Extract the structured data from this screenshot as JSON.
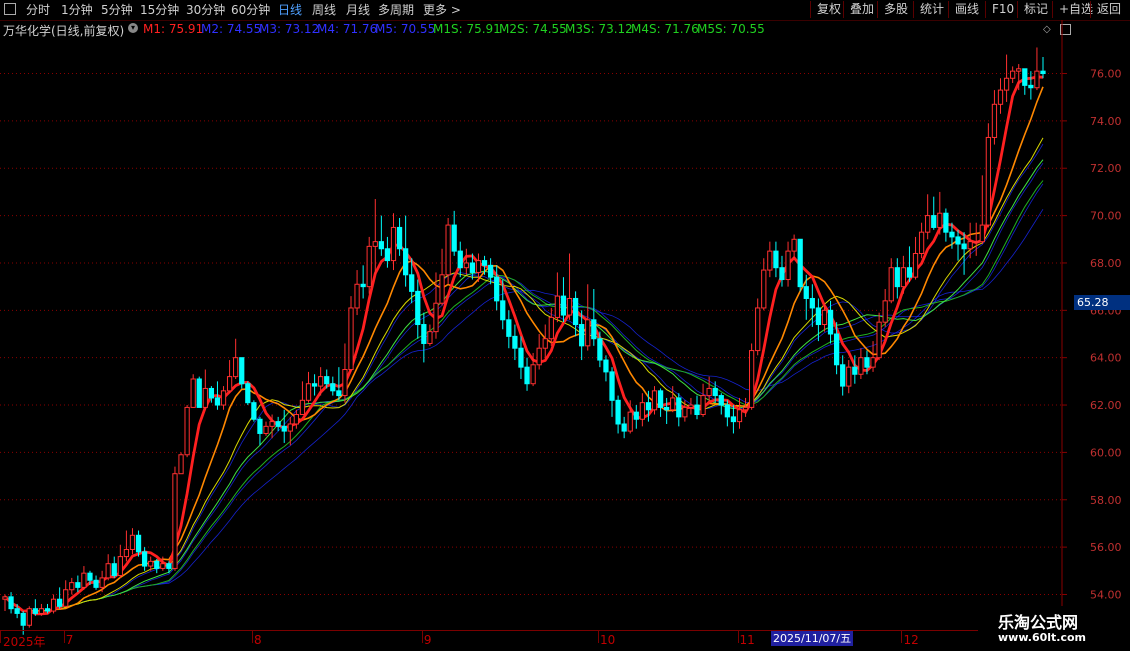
{
  "toolbar": {
    "menu_icon": "square-icon",
    "periods": [
      "分时",
      "1分钟",
      "5分钟",
      "15分钟",
      "30分钟",
      "60分钟",
      "日线",
      "周线",
      "月线",
      "多周期",
      "更多 >"
    ],
    "active_period": "日线",
    "right_buttons": [
      "复权",
      "叠加",
      "多股",
      "统计",
      "画线",
      "F10",
      "标记",
      "+自选",
      "返回"
    ]
  },
  "title": {
    "stock": "万华化学(日线,前复权)",
    "circle_icon": "chevron-down-icon",
    "m1": "M1: 75.91",
    "m2": "M2: 74.55",
    "m3": "M3: 73.12",
    "m4": "M4: 71.76",
    "m5": "M5: 70.55",
    "m1s": "M1S: 75.91",
    "m2s": "M2S: 74.55",
    "m3s": "M3S: 73.12",
    "m4s": "M4S: 71.76",
    "m5s": "M5S: 70.55",
    "colors": {
      "m1": "#ff2020",
      "m2": "#3030ff",
      "m3": "#3030ff",
      "m4": "#3030ff",
      "m5": "#3030ff",
      "ms": "#20d020"
    }
  },
  "price_tag": "65.28",
  "date_cursor": "2025/11/07/五",
  "watermark": {
    "title": "乐淘公式网",
    "url": "www.60lt.com"
  },
  "chart_data": {
    "type": "candlestick",
    "ylim": [
      52.5,
      77.5
    ],
    "y_ticks": [
      54,
      56,
      58,
      60,
      62,
      64,
      66,
      68,
      70,
      72,
      74,
      76
    ],
    "y_tick_labels": [
      "54.00",
      "56.00",
      "58.00",
      "60.00",
      "62.00",
      "64.00",
      "66.00",
      "68.00",
      "70.00",
      "72.00",
      "74.00",
      "76.00"
    ],
    "x_labels": [
      {
        "label": "2025年",
        "index": 0
      },
      {
        "label": "7",
        "index": 11
      },
      {
        "label": "8",
        "index": 42
      },
      {
        "label": "9",
        "index": 70
      },
      {
        "label": "10",
        "index": 99
      },
      {
        "label": "11",
        "index": 122
      },
      {
        "label": "12",
        "index": 149
      }
    ],
    "candles": [
      [
        53.8,
        53.9,
        53.3,
        54.0
      ],
      [
        53.9,
        53.4,
        53.2,
        54.1
      ],
      [
        53.4,
        53.2,
        53.0,
        53.6
      ],
      [
        53.2,
        52.7,
        52.3,
        53.3
      ],
      [
        52.7,
        53.4,
        52.6,
        53.5
      ],
      [
        53.4,
        53.2,
        53.1,
        53.8
      ],
      [
        53.2,
        53.4,
        53.1,
        53.6
      ],
      [
        53.4,
        53.3,
        53.2,
        53.6
      ],
      [
        53.3,
        53.8,
        53.2,
        54.0
      ],
      [
        53.8,
        53.5,
        53.4,
        54.3
      ],
      [
        53.5,
        54.2,
        53.5,
        54.6
      ],
      [
        54.2,
        54.5,
        54.0,
        54.7
      ],
      [
        54.5,
        54.3,
        54.1,
        54.8
      ],
      [
        54.3,
        54.9,
        54.2,
        55.2
      ],
      [
        54.9,
        54.6,
        54.4,
        55.0
      ],
      [
        54.6,
        54.3,
        54.2,
        54.8
      ],
      [
        54.3,
        54.7,
        54.1,
        55.0
      ],
      [
        54.7,
        55.3,
        54.6,
        55.7
      ],
      [
        55.3,
        54.8,
        54.7,
        55.6
      ],
      [
        54.8,
        55.6,
        54.7,
        56.1
      ],
      [
        55.6,
        55.9,
        55.4,
        56.7
      ],
      [
        55.9,
        56.5,
        55.7,
        56.8
      ],
      [
        56.5,
        55.8,
        55.6,
        56.7
      ],
      [
        55.8,
        55.2,
        55.0,
        56.0
      ],
      [
        55.2,
        55.4,
        55.0,
        55.6
      ],
      [
        55.4,
        55.1,
        54.9,
        55.5
      ],
      [
        55.1,
        55.3,
        55.0,
        55.6
      ],
      [
        55.3,
        55.1,
        54.9,
        55.4
      ],
      [
        55.1,
        59.1,
        55.0,
        59.4
      ],
      [
        59.1,
        59.9,
        59.1,
        60.0
      ],
      [
        59.9,
        61.9,
        59.8,
        62.0
      ],
      [
        61.9,
        63.1,
        61.9,
        63.3
      ],
      [
        63.1,
        61.9,
        61.9,
        63.2
      ],
      [
        61.9,
        62.7,
        61.8,
        63.5
      ],
      [
        62.7,
        62.3,
        62.1,
        62.8
      ],
      [
        62.3,
        62.0,
        61.8,
        63.0
      ],
      [
        62.0,
        62.6,
        61.8,
        62.8
      ],
      [
        62.6,
        63.2,
        62.5,
        63.9
      ],
      [
        63.2,
        64.0,
        63.1,
        64.8
      ],
      [
        64.0,
        62.9,
        62.7,
        64.0
      ],
      [
        62.9,
        62.1,
        62.0,
        63.0
      ],
      [
        62.1,
        61.4,
        61.3,
        62.2
      ],
      [
        61.4,
        60.8,
        60.3,
        61.5
      ],
      [
        60.8,
        61.1,
        60.7,
        61.3
      ],
      [
        61.1,
        61.3,
        60.6,
        61.6
      ],
      [
        61.3,
        61.1,
        60.9,
        61.5
      ],
      [
        61.1,
        60.9,
        60.4,
        61.8
      ],
      [
        60.9,
        61.2,
        60.3,
        61.5
      ],
      [
        61.2,
        61.6,
        61.0,
        61.8
      ],
      [
        61.6,
        62.2,
        61.6,
        63.0
      ],
      [
        62.2,
        62.9,
        62.1,
        63.4
      ],
      [
        62.9,
        62.8,
        62.4,
        63.3
      ],
      [
        62.8,
        63.2,
        62.4,
        63.6
      ],
      [
        63.2,
        62.9,
        62.7,
        63.5
      ],
      [
        62.9,
        62.6,
        62.4,
        63.2
      ],
      [
        62.6,
        62.4,
        62.2,
        63.6
      ],
      [
        62.4,
        63.5,
        62.1,
        64.6
      ],
      [
        63.5,
        66.1,
        63.4,
        66.6
      ],
      [
        66.1,
        67.1,
        65.8,
        67.7
      ],
      [
        67.1,
        67.0,
        66.5,
        67.9
      ],
      [
        67.0,
        68.7,
        66.7,
        69.1
      ],
      [
        68.7,
        68.9,
        67.5,
        70.7
      ],
      [
        68.9,
        68.6,
        68.3,
        70.0
      ],
      [
        68.6,
        68.1,
        67.8,
        69.1
      ],
      [
        68.1,
        69.5,
        67.7,
        70.1
      ],
      [
        69.5,
        68.6,
        68.3,
        69.9
      ],
      [
        68.6,
        67.5,
        67.0,
        70.0
      ],
      [
        67.5,
        66.8,
        66.3,
        68.2
      ],
      [
        66.8,
        65.4,
        64.8,
        67.3
      ],
      [
        65.4,
        64.6,
        63.8,
        65.9
      ],
      [
        64.6,
        65.1,
        64.5,
        65.4
      ],
      [
        65.1,
        66.3,
        64.8,
        67.6
      ],
      [
        66.3,
        67.5,
        66.2,
        68.6
      ],
      [
        67.5,
        69.6,
        67.1,
        69.9
      ],
      [
        69.6,
        68.5,
        68.3,
        70.2
      ],
      [
        68.5,
        67.8,
        67.4,
        68.9
      ],
      [
        67.8,
        68.0,
        67.5,
        68.6
      ],
      [
        68.0,
        67.6,
        67.3,
        68.4
      ],
      [
        67.6,
        68.1,
        67.2,
        68.4
      ],
      [
        68.1,
        67.9,
        67.5,
        68.3
      ],
      [
        67.9,
        67.4,
        67.1,
        68.2
      ],
      [
        67.4,
        66.4,
        66.0,
        67.9
      ],
      [
        66.4,
        65.6,
        65.2,
        67.3
      ],
      [
        65.6,
        64.9,
        64.4,
        66.0
      ],
      [
        64.9,
        64.4,
        63.9,
        65.4
      ],
      [
        64.4,
        63.6,
        63.1,
        64.9
      ],
      [
        63.6,
        62.9,
        62.6,
        64.0
      ],
      [
        62.9,
        63.7,
        62.8,
        64.2
      ],
      [
        63.7,
        64.4,
        63.5,
        65.0
      ],
      [
        64.4,
        64.8,
        64.0,
        65.4
      ],
      [
        64.8,
        65.7,
        64.5,
        66.1
      ],
      [
        65.7,
        66.6,
        65.5,
        67.6
      ],
      [
        66.6,
        65.8,
        65.5,
        67.4
      ],
      [
        65.8,
        66.5,
        65.6,
        68.4
      ],
      [
        66.5,
        65.4,
        64.9,
        66.8
      ],
      [
        65.4,
        64.5,
        63.9,
        66.0
      ],
      [
        64.5,
        65.6,
        64.3,
        67.1
      ],
      [
        65.6,
        64.8,
        64.5,
        66.9
      ],
      [
        64.8,
        63.9,
        63.6,
        65.1
      ],
      [
        63.9,
        63.4,
        63.0,
        64.1
      ],
      [
        63.4,
        62.2,
        61.5,
        63.6
      ],
      [
        62.2,
        61.2,
        60.8,
        62.4
      ],
      [
        61.2,
        60.9,
        60.6,
        61.5
      ],
      [
        60.9,
        61.7,
        60.8,
        62.2
      ],
      [
        61.7,
        61.4,
        61.0,
        62.0
      ],
      [
        61.4,
        62.1,
        61.1,
        62.5
      ],
      [
        62.1,
        61.8,
        61.3,
        62.6
      ],
      [
        61.8,
        62.6,
        61.6,
        62.8
      ],
      [
        62.6,
        61.9,
        61.5,
        62.7
      ],
      [
        61.9,
        61.8,
        61.2,
        62.3
      ],
      [
        61.8,
        62.3,
        61.7,
        62.8
      ],
      [
        62.3,
        61.5,
        61.1,
        62.5
      ],
      [
        61.5,
        61.9,
        61.3,
        62.2
      ],
      [
        61.9,
        62.0,
        61.6,
        62.3
      ],
      [
        62.0,
        61.6,
        61.4,
        62.4
      ],
      [
        61.6,
        62.4,
        61.5,
        62.9
      ],
      [
        62.4,
        62.7,
        62.2,
        63.2
      ],
      [
        62.7,
        62.4,
        62.1,
        63.0
      ],
      [
        62.4,
        62.0,
        61.6,
        62.5
      ],
      [
        62.0,
        61.5,
        61.1,
        62.2
      ],
      [
        61.5,
        61.3,
        60.8,
        62.0
      ],
      [
        61.3,
        61.8,
        61.0,
        62.3
      ],
      [
        61.8,
        61.9,
        61.5,
        62.3
      ],
      [
        61.9,
        64.3,
        61.8,
        64.6
      ],
      [
        64.3,
        66.1,
        64.1,
        66.5
      ],
      [
        66.1,
        67.7,
        66.0,
        68.2
      ],
      [
        67.7,
        68.5,
        67.4,
        68.9
      ],
      [
        68.5,
        67.8,
        67.4,
        68.9
      ],
      [
        67.8,
        67.3,
        67.0,
        68.3
      ],
      [
        67.3,
        68.5,
        67.0,
        68.9
      ],
      [
        68.5,
        69.0,
        68.2,
        69.2
      ],
      [
        69.0,
        67.0,
        66.8,
        69.0
      ],
      [
        67.0,
        66.5,
        65.6,
        67.5
      ],
      [
        66.5,
        66.1,
        65.3,
        67.1
      ],
      [
        66.1,
        65.4,
        64.7,
        66.5
      ],
      [
        65.4,
        66.0,
        65.1,
        66.3
      ],
      [
        66.0,
        65.0,
        64.6,
        66.4
      ],
      [
        65.0,
        63.7,
        63.3,
        65.5
      ],
      [
        63.7,
        62.8,
        62.4,
        64.1
      ],
      [
        62.8,
        63.6,
        62.5,
        63.9
      ],
      [
        63.6,
        63.3,
        62.9,
        64.1
      ],
      [
        63.3,
        64.0,
        63.1,
        64.4
      ],
      [
        64.0,
        63.6,
        63.3,
        64.3
      ],
      [
        63.6,
        64.0,
        63.4,
        64.7
      ],
      [
        64.0,
        65.5,
        63.9,
        65.9
      ],
      [
        65.5,
        66.4,
        65.3,
        66.9
      ],
      [
        66.4,
        67.8,
        66.3,
        68.2
      ],
      [
        67.8,
        67.0,
        66.5,
        68.2
      ],
      [
        67.0,
        67.8,
        66.7,
        68.3
      ],
      [
        67.8,
        67.4,
        67.2,
        68.7
      ],
      [
        67.4,
        68.4,
        67.3,
        69.1
      ],
      [
        68.4,
        69.3,
        68.2,
        69.7
      ],
      [
        69.3,
        70.0,
        69.0,
        70.9
      ],
      [
        70.0,
        69.5,
        69.4,
        70.8
      ],
      [
        69.5,
        70.1,
        69.2,
        71.0
      ],
      [
        70.1,
        69.3,
        68.9,
        70.3
      ],
      [
        69.3,
        69.1,
        68.6,
        69.7
      ],
      [
        69.1,
        68.8,
        68.1,
        69.4
      ],
      [
        68.8,
        68.6,
        67.5,
        69.3
      ],
      [
        68.6,
        68.9,
        68.2,
        69.7
      ],
      [
        68.9,
        68.9,
        68.3,
        69.7
      ],
      [
        68.9,
        69.6,
        68.8,
        71.7
      ],
      [
        69.6,
        73.3,
        69.5,
        73.9
      ],
      [
        73.3,
        74.7,
        73.0,
        75.3
      ],
      [
        74.7,
        75.3,
        74.3,
        75.8
      ],
      [
        75.3,
        75.8,
        74.8,
        76.8
      ],
      [
        75.8,
        76.1,
        75.6,
        76.3
      ],
      [
        76.1,
        76.2,
        75.3,
        76.4
      ],
      [
        76.2,
        75.5,
        75.1,
        76.1
      ],
      [
        75.5,
        75.4,
        74.9,
        76.1
      ],
      [
        75.4,
        76.1,
        75.3,
        77.1
      ],
      [
        76.1,
        76.0,
        75.8,
        76.7
      ]
    ],
    "ma_periods": [
      5,
      10,
      15,
      20,
      25
    ],
    "ma_colors": [
      "#ff2020",
      "#ff8800",
      "#d8d800",
      "#40e040",
      "#20b020"
    ],
    "ma_widths": [
      2.8,
      1.6,
      1.0,
      1.0,
      1.0
    ],
    "up_color": "#ff3030",
    "down_color": "#00ffff",
    "grid_color": "#8a0000"
  }
}
